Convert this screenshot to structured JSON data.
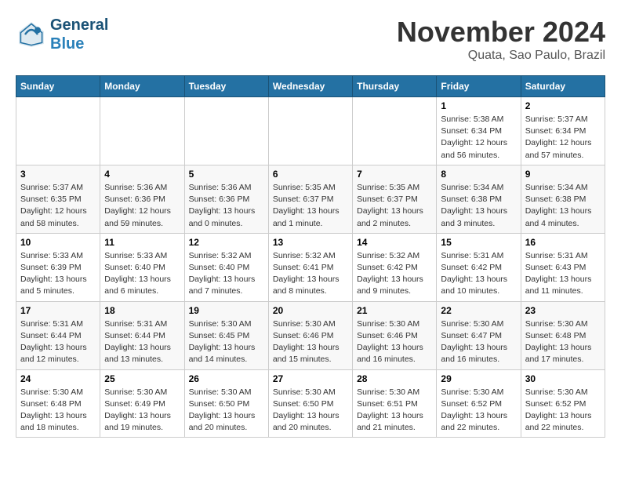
{
  "header": {
    "logo_line1": "General",
    "logo_line2": "Blue",
    "month_title": "November 2024",
    "location": "Quata, Sao Paulo, Brazil"
  },
  "weekdays": [
    "Sunday",
    "Monday",
    "Tuesday",
    "Wednesday",
    "Thursday",
    "Friday",
    "Saturday"
  ],
  "weeks": [
    [
      {
        "day": "",
        "info": ""
      },
      {
        "day": "",
        "info": ""
      },
      {
        "day": "",
        "info": ""
      },
      {
        "day": "",
        "info": ""
      },
      {
        "day": "",
        "info": ""
      },
      {
        "day": "1",
        "info": "Sunrise: 5:38 AM\nSunset: 6:34 PM\nDaylight: 12 hours\nand 56 minutes."
      },
      {
        "day": "2",
        "info": "Sunrise: 5:37 AM\nSunset: 6:34 PM\nDaylight: 12 hours\nand 57 minutes."
      }
    ],
    [
      {
        "day": "3",
        "info": "Sunrise: 5:37 AM\nSunset: 6:35 PM\nDaylight: 12 hours\nand 58 minutes."
      },
      {
        "day": "4",
        "info": "Sunrise: 5:36 AM\nSunset: 6:36 PM\nDaylight: 12 hours\nand 59 minutes."
      },
      {
        "day": "5",
        "info": "Sunrise: 5:36 AM\nSunset: 6:36 PM\nDaylight: 13 hours\nand 0 minutes."
      },
      {
        "day": "6",
        "info": "Sunrise: 5:35 AM\nSunset: 6:37 PM\nDaylight: 13 hours\nand 1 minute."
      },
      {
        "day": "7",
        "info": "Sunrise: 5:35 AM\nSunset: 6:37 PM\nDaylight: 13 hours\nand 2 minutes."
      },
      {
        "day": "8",
        "info": "Sunrise: 5:34 AM\nSunset: 6:38 PM\nDaylight: 13 hours\nand 3 minutes."
      },
      {
        "day": "9",
        "info": "Sunrise: 5:34 AM\nSunset: 6:38 PM\nDaylight: 13 hours\nand 4 minutes."
      }
    ],
    [
      {
        "day": "10",
        "info": "Sunrise: 5:33 AM\nSunset: 6:39 PM\nDaylight: 13 hours\nand 5 minutes."
      },
      {
        "day": "11",
        "info": "Sunrise: 5:33 AM\nSunset: 6:40 PM\nDaylight: 13 hours\nand 6 minutes."
      },
      {
        "day": "12",
        "info": "Sunrise: 5:32 AM\nSunset: 6:40 PM\nDaylight: 13 hours\nand 7 minutes."
      },
      {
        "day": "13",
        "info": "Sunrise: 5:32 AM\nSunset: 6:41 PM\nDaylight: 13 hours\nand 8 minutes."
      },
      {
        "day": "14",
        "info": "Sunrise: 5:32 AM\nSunset: 6:42 PM\nDaylight: 13 hours\nand 9 minutes."
      },
      {
        "day": "15",
        "info": "Sunrise: 5:31 AM\nSunset: 6:42 PM\nDaylight: 13 hours\nand 10 minutes."
      },
      {
        "day": "16",
        "info": "Sunrise: 5:31 AM\nSunset: 6:43 PM\nDaylight: 13 hours\nand 11 minutes."
      }
    ],
    [
      {
        "day": "17",
        "info": "Sunrise: 5:31 AM\nSunset: 6:44 PM\nDaylight: 13 hours\nand 12 minutes."
      },
      {
        "day": "18",
        "info": "Sunrise: 5:31 AM\nSunset: 6:44 PM\nDaylight: 13 hours\nand 13 minutes."
      },
      {
        "day": "19",
        "info": "Sunrise: 5:30 AM\nSunset: 6:45 PM\nDaylight: 13 hours\nand 14 minutes."
      },
      {
        "day": "20",
        "info": "Sunrise: 5:30 AM\nSunset: 6:46 PM\nDaylight: 13 hours\nand 15 minutes."
      },
      {
        "day": "21",
        "info": "Sunrise: 5:30 AM\nSunset: 6:46 PM\nDaylight: 13 hours\nand 16 minutes."
      },
      {
        "day": "22",
        "info": "Sunrise: 5:30 AM\nSunset: 6:47 PM\nDaylight: 13 hours\nand 16 minutes."
      },
      {
        "day": "23",
        "info": "Sunrise: 5:30 AM\nSunset: 6:48 PM\nDaylight: 13 hours\nand 17 minutes."
      }
    ],
    [
      {
        "day": "24",
        "info": "Sunrise: 5:30 AM\nSunset: 6:48 PM\nDaylight: 13 hours\nand 18 minutes."
      },
      {
        "day": "25",
        "info": "Sunrise: 5:30 AM\nSunset: 6:49 PM\nDaylight: 13 hours\nand 19 minutes."
      },
      {
        "day": "26",
        "info": "Sunrise: 5:30 AM\nSunset: 6:50 PM\nDaylight: 13 hours\nand 20 minutes."
      },
      {
        "day": "27",
        "info": "Sunrise: 5:30 AM\nSunset: 6:50 PM\nDaylight: 13 hours\nand 20 minutes."
      },
      {
        "day": "28",
        "info": "Sunrise: 5:30 AM\nSunset: 6:51 PM\nDaylight: 13 hours\nand 21 minutes."
      },
      {
        "day": "29",
        "info": "Sunrise: 5:30 AM\nSunset: 6:52 PM\nDaylight: 13 hours\nand 22 minutes."
      },
      {
        "day": "30",
        "info": "Sunrise: 5:30 AM\nSunset: 6:52 PM\nDaylight: 13 hours\nand 22 minutes."
      }
    ]
  ]
}
